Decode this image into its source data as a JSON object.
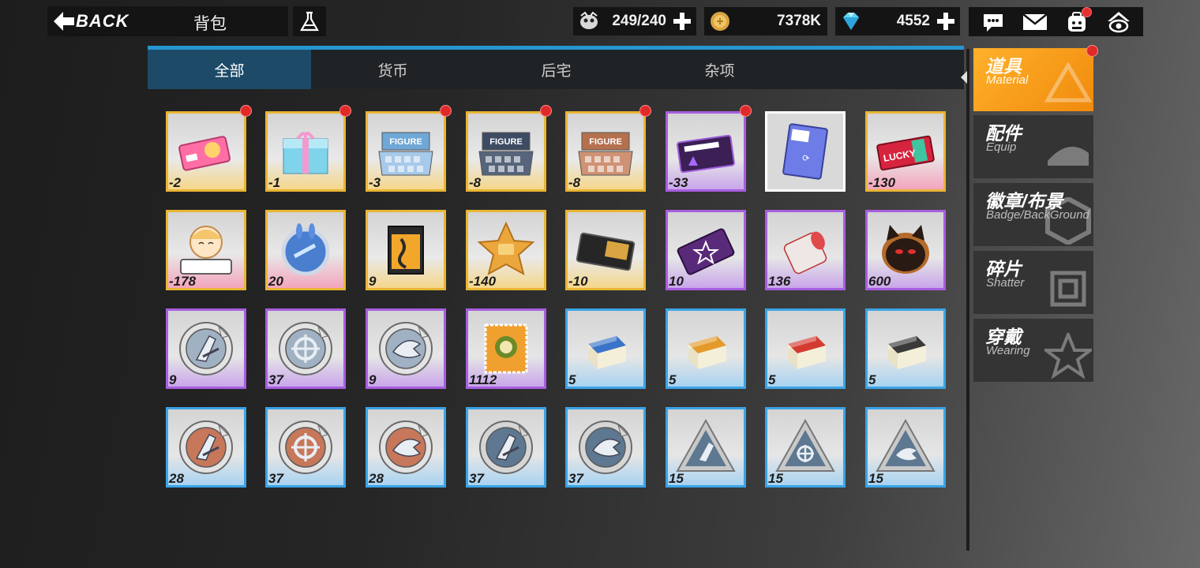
{
  "header": {
    "back_label": "BACK",
    "title": "背包"
  },
  "resources": [
    {
      "icon": "stamina-icon",
      "value": "249/240",
      "has_plus": true
    },
    {
      "icon": "gold-coin-icon",
      "value": "7378K",
      "has_plus": false
    },
    {
      "icon": "diamond-icon",
      "value": "4552",
      "has_plus": true
    }
  ],
  "tabs": [
    {
      "label": "全部",
      "active": true
    },
    {
      "label": "货币",
      "active": false
    },
    {
      "label": "后宅",
      "active": false
    },
    {
      "label": "杂项",
      "active": false
    }
  ],
  "items": [
    {
      "count": "-2",
      "rarity": "gold",
      "art": "pink-ticket",
      "new": true
    },
    {
      "count": "-1",
      "rarity": "gold",
      "art": "gift-box",
      "new": true
    },
    {
      "count": "-3",
      "rarity": "gold",
      "art": "figure-box-blue",
      "new": true
    },
    {
      "count": "-8",
      "rarity": "gold",
      "art": "figure-box-dark",
      "new": true
    },
    {
      "count": "-8",
      "rarity": "gold",
      "art": "figure-box-bronze",
      "new": true
    },
    {
      "count": "-33",
      "rarity": "purple",
      "art": "purple-card",
      "new": true
    },
    {
      "count": "",
      "rarity": "white",
      "art": "rename-card",
      "new": false
    },
    {
      "count": "-130",
      "rarity": "pink",
      "art": "lucky-ticket",
      "new": false
    },
    {
      "count": "-178",
      "rarity": "pink",
      "art": "figurestory-badge",
      "new": false
    },
    {
      "count": "20",
      "rarity": "pink",
      "art": "rabbit-orb",
      "new": false
    },
    {
      "count": "9",
      "rarity": "gold",
      "art": "poster-book",
      "new": false
    },
    {
      "count": "-140",
      "rarity": "gold",
      "art": "gold-star",
      "new": false
    },
    {
      "count": "-10",
      "rarity": "gold",
      "art": "black-ticket",
      "new": false
    },
    {
      "count": "10",
      "rarity": "purple",
      "art": "badge-scroll",
      "new": false
    },
    {
      "count": "136",
      "rarity": "purple",
      "art": "paper-roll",
      "new": false
    },
    {
      "count": "600",
      "rarity": "purple",
      "art": "cat-cookie",
      "new": false
    },
    {
      "count": "9",
      "rarity": "purple",
      "art": "silver-medal-blade",
      "new": false
    },
    {
      "count": "37",
      "rarity": "purple",
      "art": "silver-medal-target",
      "new": false
    },
    {
      "count": "9",
      "rarity": "purple",
      "art": "silver-medal-fish",
      "new": false
    },
    {
      "count": "1112",
      "rarity": "purple",
      "art": "stamp",
      "new": false
    },
    {
      "count": "5",
      "rarity": "blue",
      "art": "eraser-blue",
      "new": false
    },
    {
      "count": "5",
      "rarity": "blue",
      "art": "eraser-orange",
      "new": false
    },
    {
      "count": "5",
      "rarity": "blue",
      "art": "eraser-red",
      "new": false
    },
    {
      "count": "5",
      "rarity": "blue",
      "art": "eraser-dark",
      "new": false
    },
    {
      "count": "28",
      "rarity": "blue",
      "art": "bronze-medal-blade",
      "new": false
    },
    {
      "count": "37",
      "rarity": "blue",
      "art": "bronze-medal-target",
      "new": false
    },
    {
      "count": "28",
      "rarity": "blue",
      "art": "bronze-medal-fish",
      "new": false
    },
    {
      "count": "37",
      "rarity": "blue",
      "art": "steel-medal-blade",
      "new": false
    },
    {
      "count": "37",
      "rarity": "blue",
      "art": "steel-medal-fish",
      "new": false
    },
    {
      "count": "15",
      "rarity": "blue",
      "art": "triangle-blade",
      "new": false
    },
    {
      "count": "15",
      "rarity": "blue",
      "art": "triangle-target",
      "new": false
    },
    {
      "count": "15",
      "rarity": "blue",
      "art": "triangle-fish",
      "new": false
    }
  ],
  "categories": [
    {
      "cn": "道具",
      "en": "Material",
      "active": true,
      "new": true
    },
    {
      "cn": "配件",
      "en": "Equip",
      "active": false,
      "new": false
    },
    {
      "cn": "徽章/布景",
      "en": "Badge/BackGround",
      "active": false,
      "new": false
    },
    {
      "cn": "碎片",
      "en": "Shatter",
      "active": false,
      "new": false
    },
    {
      "cn": "穿戴",
      "en": "Wearing",
      "active": false,
      "new": false
    }
  ],
  "colors": {
    "accent_blue": "#2596d0",
    "active_tab": "#1d4b67",
    "active_category": "#ffa51f",
    "rarity_gold": "#e9b534",
    "rarity_purple": "#a85ee0",
    "rarity_blue": "#3aa4e6",
    "notification_red": "#e02a2a"
  }
}
